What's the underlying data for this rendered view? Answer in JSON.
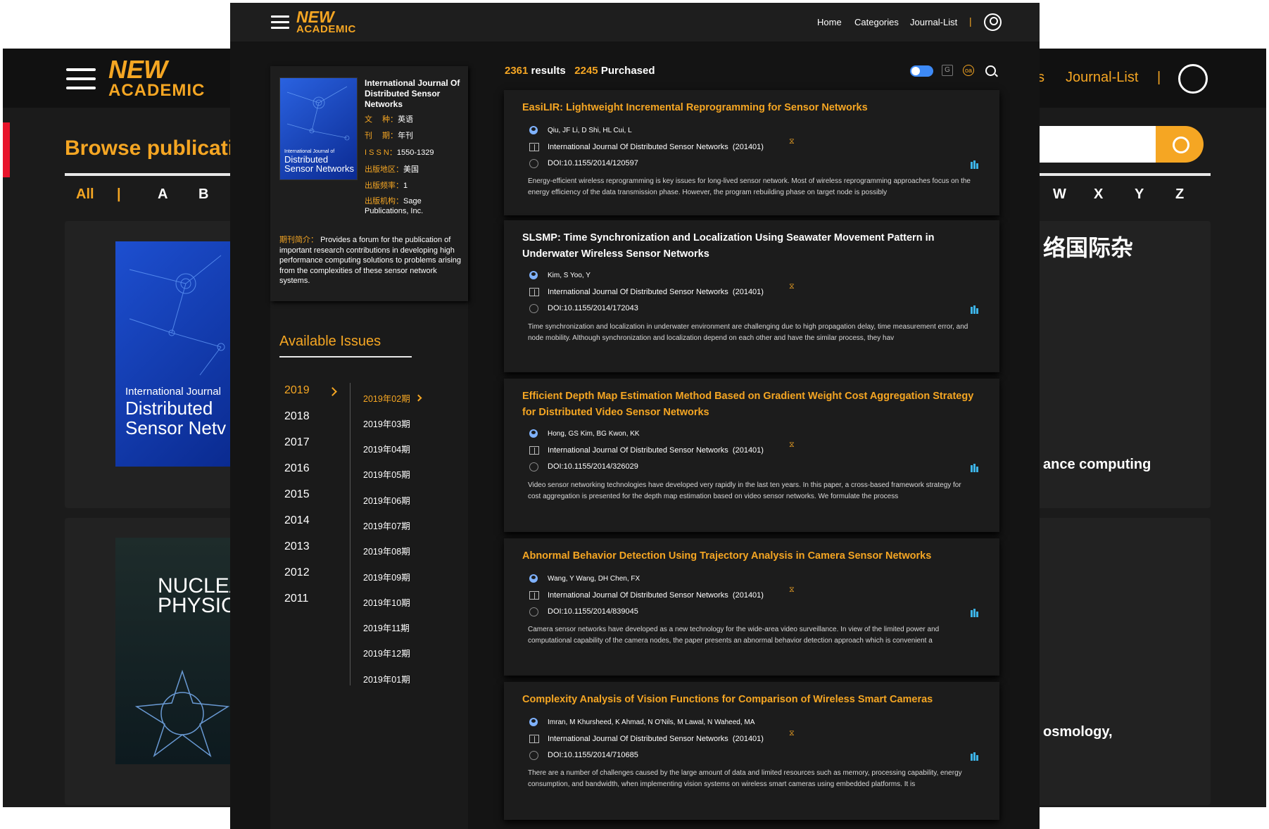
{
  "background": {
    "logo_top": "NEW",
    "logo_bottom": "ACADEMIC",
    "browse_title": "Browse publicati",
    "alpha_left": [
      "All",
      "|",
      "A",
      "B"
    ],
    "alpha_right": [
      "W",
      "X",
      "Y",
      "Z"
    ],
    "nav_partial": "s",
    "nav_journal_list": "Journal-List",
    "nav_sep": "|",
    "cover1_small": "International Journal",
    "cover1_line1": "Distributed",
    "cover1_line2": "Sensor Netv",
    "cover2_line1": "NUCLEA",
    "cover2_line2": "PHYSIC",
    "right_cjk": "络国际杂",
    "right_text1": "ance computing",
    "right_text2": "osmology,"
  },
  "header": {
    "logo_top": "NEW",
    "logo_bottom": "ACADEMIC",
    "nav": [
      "Home",
      "Categories",
      "Journal-List"
    ],
    "nav_sep": "|"
  },
  "journal": {
    "cover_small": "International Journal of",
    "cover_line1": "Distributed",
    "cover_line2": "Sensor Networks",
    "title": "International Journal Of Distributed Sensor Networks",
    "meta": [
      {
        "k": "文　 种：",
        "v": "英语"
      },
      {
        "k": "刊　 期：",
        "v": "年刊"
      },
      {
        "k": "I S S N：",
        "v": "1550-1329"
      },
      {
        "k": "出版地区：",
        "v": "美国"
      },
      {
        "k": "出版频率：",
        "v": "1"
      },
      {
        "k": "出版机构：",
        "v": "Sage Publications, Inc."
      }
    ],
    "intro_key": "期刊简介：",
    "intro_text": "Provides a forum for the publication of important research contributions in developing high performance computing solutions to problems arising from the complexities of these sensor network systems."
  },
  "issues": {
    "title": "Available Issues",
    "years": [
      "2019",
      "2018",
      "2017",
      "2016",
      "2015",
      "2014",
      "2013",
      "2012",
      "2011"
    ],
    "active_year": "2019",
    "list": [
      "2019年02期",
      "2019年03期",
      "2019年04期",
      "2019年05期",
      "2019年06期",
      "2019年07期",
      "2019年08期",
      "2019年09期",
      "2019年10期",
      "2019年11期",
      "2019年12期",
      "2019年01期"
    ]
  },
  "results": {
    "count": "2361",
    "count_label": "results",
    "purchased": "2245",
    "purchased_label": "Purchased",
    "tool_g": "G",
    "tool_oa": "oa"
  },
  "articles": [
    {
      "title": "EasiLIR: Lightweight Incremental Reprogramming for Sensor Networks",
      "authors": "Qiu, JF   Li, D   Shi, HL   Cui, L",
      "journal": "International Journal Of Distributed Sensor Networks",
      "issue": "(201401)",
      "doi": "DOI:10.1155/2014/120597",
      "abstract": "Energy-efficient wireless reprogramming is key issues for long-lived sensor network. Most of wireless reprogramming approaches focus on the energy efficiency of the data transmission phase. However, the program rebuilding phase on target node is possibly"
    },
    {
      "title": "SLSMP: Time Synchronization and Localization Using Seawater Movement Pattern in Underwater Wireless Sensor Networks",
      "authors": "Kim, S   Yoo, Y",
      "journal": "International Journal Of Distributed Sensor Networks",
      "issue": "(201401)",
      "doi": "DOI:10.1155/2014/172043",
      "abstract": "Time synchronization and localization in underwater environment are challenging due to high propagation delay, time measurement error, and node mobility. Although synchronization and localization depend on each other and have the similar process, they hav"
    },
    {
      "title": "Efficient Depth Map Estimation Method Based on Gradient Weight Cost Aggregation Strategy for Distributed Video Sensor Networks",
      "authors": "Hong, GS   Kim, BG   Kwon, KK",
      "journal": "International Journal Of Distributed Sensor Networks",
      "issue": "(201401)",
      "doi": "DOI:10.1155/2014/326029",
      "abstract": "Video sensor networking technologies have developed very rapidly in the last ten years. In this paper, a cross-based framework strategy for cost aggregation is presented for the depth map estimation based on video sensor networks. We formulate the process"
    },
    {
      "title": "Abnormal Behavior Detection Using Trajectory Analysis in Camera Sensor Networks",
      "authors": "Wang, Y   Wang, DH   Chen, FX",
      "journal": "International Journal Of Distributed Sensor Networks",
      "issue": "(201401)",
      "doi": "DOI:10.1155/2014/839045",
      "abstract": "Camera sensor networks have developed as a new technology for the wide-area video surveillance. In view of the limited power and computational capability of the camera nodes, the paper presents an abnormal behavior detection approach which is convenient a"
    },
    {
      "title": "Complexity Analysis of Vision Functions for Comparison of Wireless Smart Cameras",
      "authors": "Imran, M   Khursheed, K   Ahmad, N   O'Nils, M   Lawal, N   Waheed, MA",
      "journal": "International Journal Of Distributed Sensor Networks",
      "issue": "(201401)",
      "doi": "DOI:10.1155/2014/710685",
      "abstract": "There are a number of challenges caused by the large amount of data and limited resources such as memory, processing capability, energy consumption, and bandwidth, when implementing vision systems on wireless smart cameras using embedded platforms. It is"
    }
  ],
  "colors": {
    "accent": "#f5a623",
    "background": "#141414",
    "card": "#1c1c1c",
    "toggle": "#3d8af7",
    "stats_icon": "#3db4e8"
  },
  "icons": [
    "hamburger-icon",
    "user-icon",
    "search-icon",
    "person-icon",
    "book-icon",
    "doi-icon",
    "rss-icon",
    "stats-icon",
    "chevron-right-icon",
    "toggle-switch",
    "google-scholar-icon",
    "open-access-icon"
  ]
}
